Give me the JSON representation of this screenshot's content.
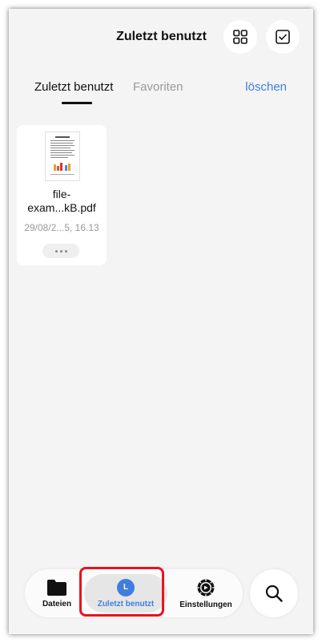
{
  "header": {
    "title": "Zuletzt benutzt",
    "grid_view_icon": "grid-icon",
    "select_icon": "checkbox-icon"
  },
  "tabs": [
    {
      "label": "Zuletzt benutzt",
      "active": true
    },
    {
      "label": "Favoriten",
      "active": false
    }
  ],
  "clear_label": "löschen",
  "files": [
    {
      "name_line1": "file-",
      "name_line2": "exam...kB.pdf",
      "date": "29/08/2...5, 16.13",
      "more_icon": "more-dots-icon"
    }
  ],
  "bottom_nav": {
    "items": [
      {
        "label": "Dateien",
        "icon": "folder-icon",
        "active": false
      },
      {
        "label": "Zuletzt benutzt",
        "icon": "clock-icon",
        "active": true,
        "badge": "L"
      },
      {
        "label": "Einstellungen",
        "icon": "gear-icon",
        "active": false
      }
    ],
    "search_icon": "search-icon"
  },
  "colors": {
    "accent": "#3f7ee0",
    "highlight": "#e8141e",
    "background": "#f4f4f5"
  }
}
